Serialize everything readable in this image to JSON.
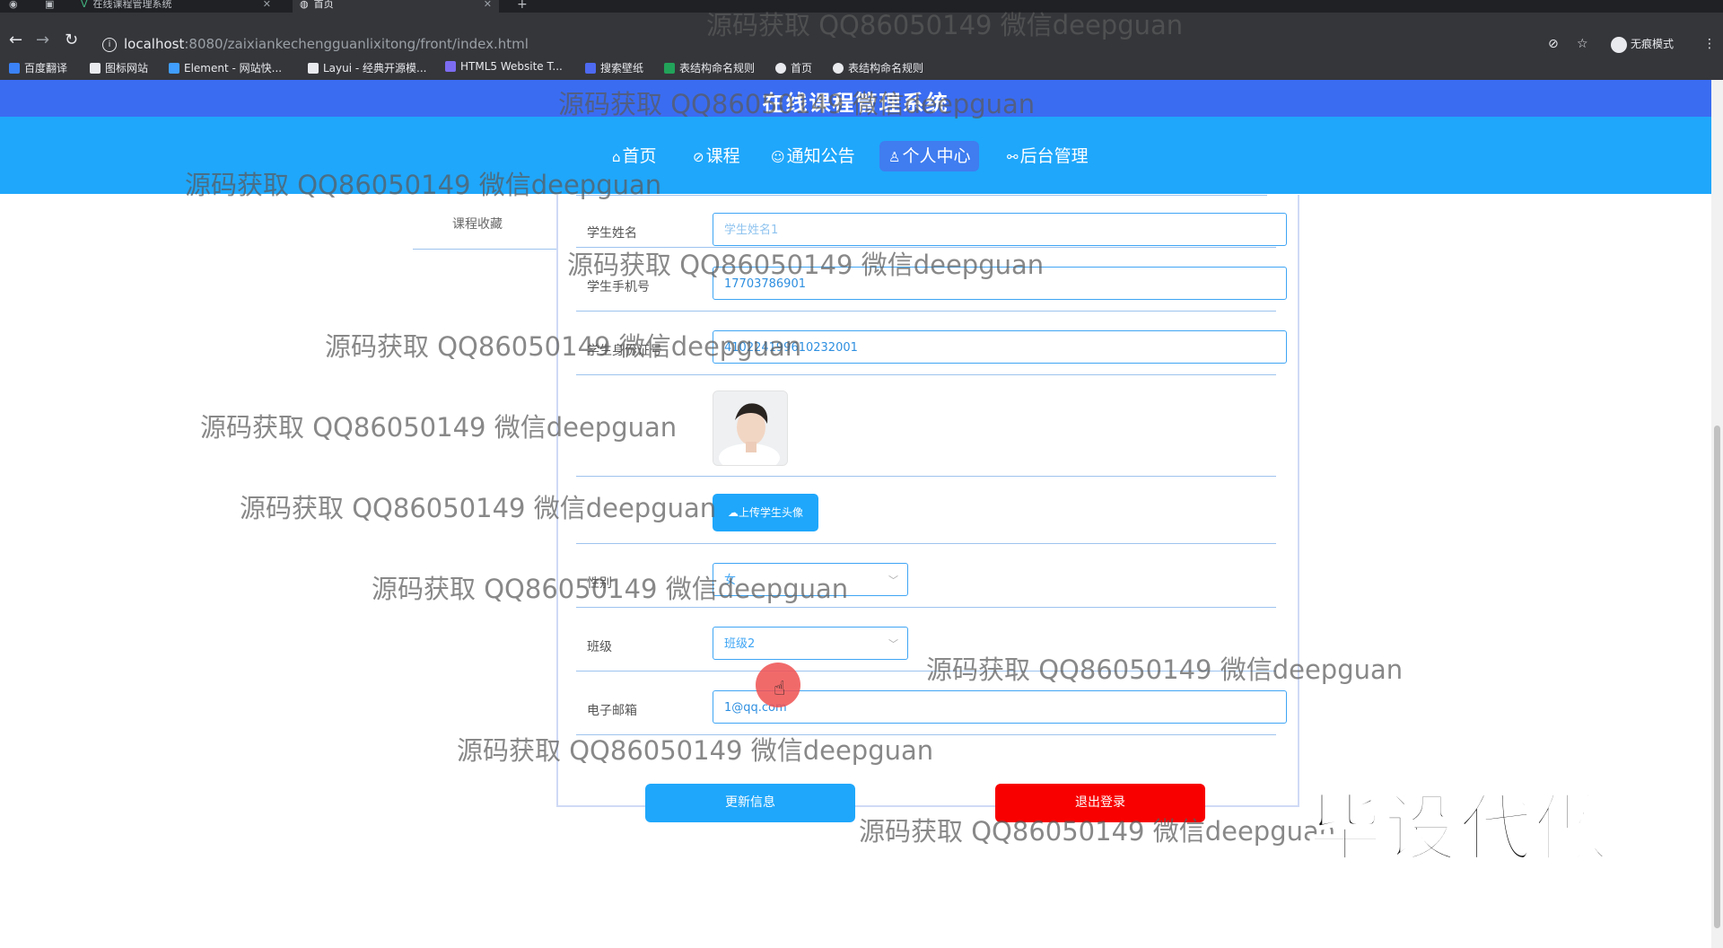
{
  "browser": {
    "tabs": [
      {
        "title": "在线课程管理系统",
        "close": "✕"
      },
      {
        "title": "首页",
        "close": "✕"
      }
    ],
    "new_tab": "+",
    "url_host": "localhost",
    "url_rest": ":8080/zaixiankechengguanlixitong/front/index.html",
    "incognito_label": "无痕模式",
    "bookmarks": [
      {
        "label": "百度翻译",
        "color": "#3b82f6"
      },
      {
        "label": "图标网站",
        "color": "#e8eaed"
      },
      {
        "label": "Element - 网站快...",
        "color": "#409eff"
      },
      {
        "label": "Layui - 经典开源模...",
        "color": "#e8eaed"
      },
      {
        "label": "HTML5 Website T...",
        "color": "#7c6cf2"
      },
      {
        "label": "搜索壁纸",
        "color": "#4d6af0"
      },
      {
        "label": "表结构命名规则",
        "color": "#22a35a"
      },
      {
        "label": "首页",
        "color": "#e8eaed"
      },
      {
        "label": "表结构命名规则",
        "color": "#e8eaed"
      }
    ]
  },
  "site": {
    "title": "在线课程管理系统",
    "nav": [
      {
        "icon": "⌂",
        "label": "首页"
      },
      {
        "icon": "⊘",
        "label": "课程"
      },
      {
        "icon": "☺",
        "label": "通知公告"
      },
      {
        "icon": "♙",
        "label": "个人中心"
      },
      {
        "icon": "⚯",
        "label": "后台管理"
      }
    ],
    "side_link": "课程收藏"
  },
  "form": {
    "student_name_label": "学生姓名",
    "student_name_value": "学生姓名1",
    "phone_label": "学生手机号",
    "phone_value": "17703786901",
    "id_label": "学生身份证号",
    "id_value": "410224199610232001",
    "upload_label": "上传学生头像",
    "gender_label": "性别",
    "gender_value": "女",
    "class_label": "班级",
    "class_value": "班级2",
    "email_label": "电子邮箱",
    "email_value": "1@qq.com",
    "update_button": "更新信息",
    "logout_button": "退出登录"
  },
  "watermark": "源码获取 QQ86050149 微信deepguan",
  "stamp": "毕设代做"
}
